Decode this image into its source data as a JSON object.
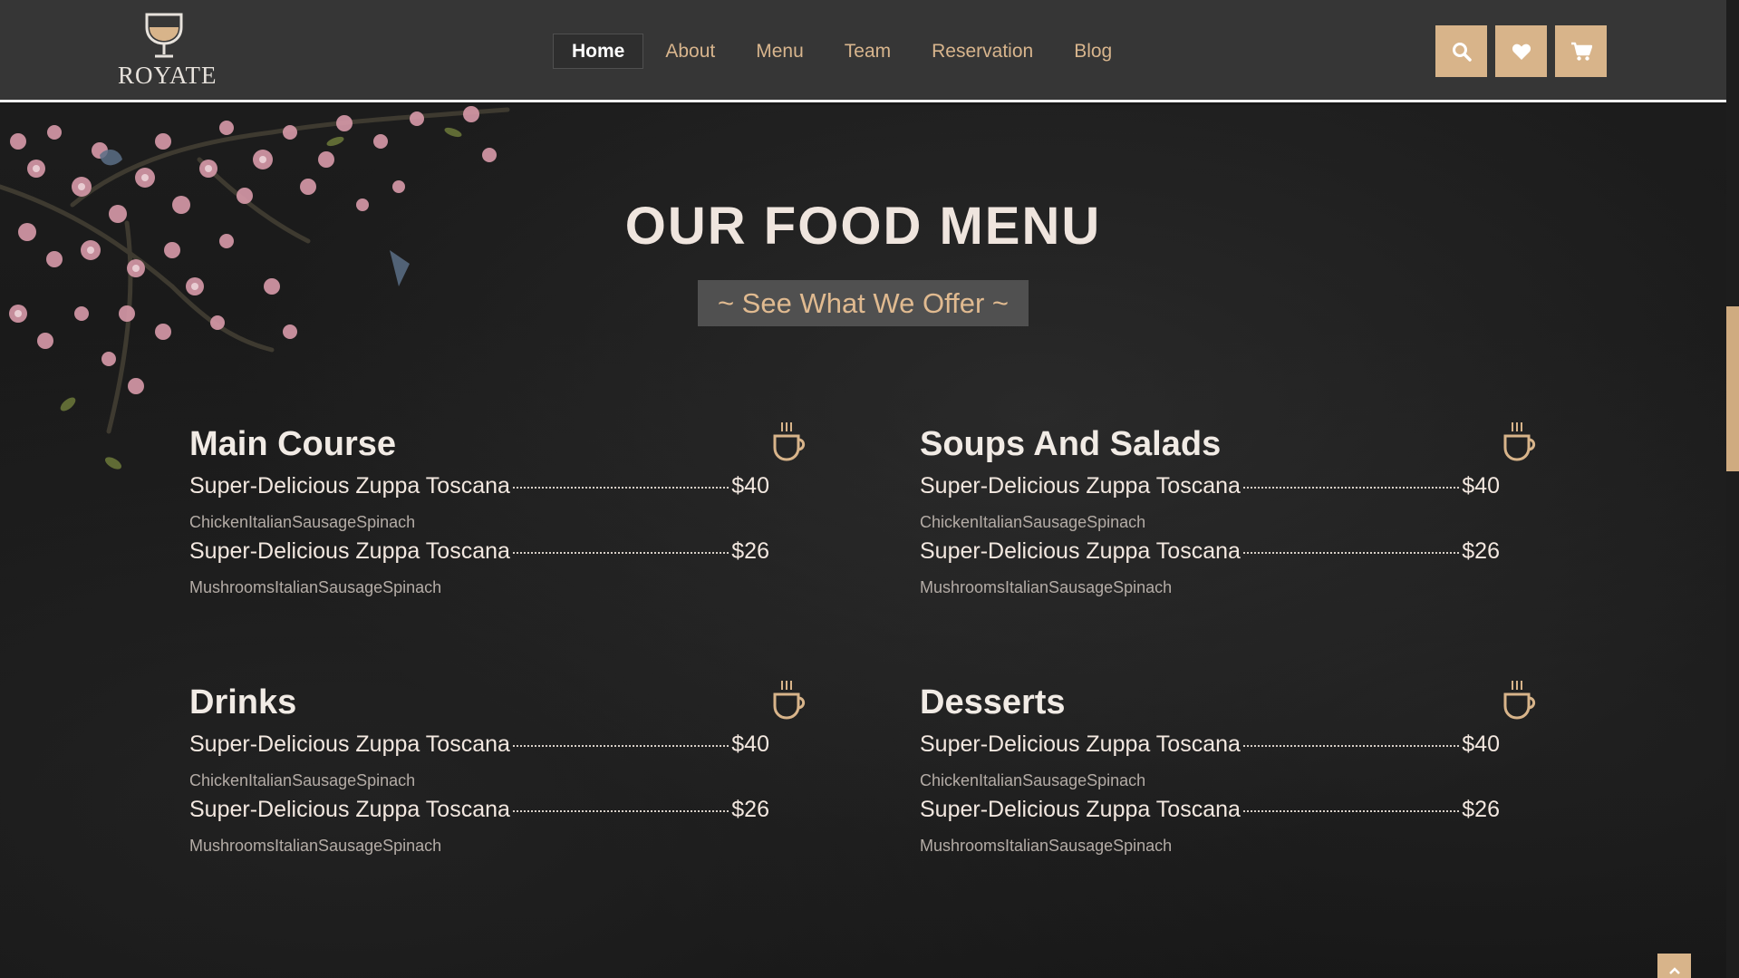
{
  "brand": {
    "name": "ROYATE"
  },
  "nav": {
    "items": [
      {
        "label": "Home",
        "active": true
      },
      {
        "label": "About",
        "active": false
      },
      {
        "label": "Menu",
        "active": false
      },
      {
        "label": "Team",
        "active": false
      },
      {
        "label": "Reservation",
        "active": false
      },
      {
        "label": "Blog",
        "active": false
      }
    ]
  },
  "header_icons": [
    "search-icon",
    "heart-icon",
    "cart-icon"
  ],
  "section": {
    "title": "OUR FOOD MENU",
    "subtitle": "~ See What We Offer ~"
  },
  "menu": [
    {
      "title": "Main Course",
      "items": [
        {
          "name": "Super-Delicious Zuppa Toscana",
          "price": "$40",
          "desc": "ChickenItalianSausageSpinach"
        },
        {
          "name": "Super-Delicious Zuppa Toscana",
          "price": "$26",
          "desc": "MushroomsItalianSausageSpinach"
        }
      ]
    },
    {
      "title": "Soups And Salads",
      "items": [
        {
          "name": "Super-Delicious Zuppa Toscana",
          "price": "$40",
          "desc": "ChickenItalianSausageSpinach"
        },
        {
          "name": "Super-Delicious Zuppa Toscana",
          "price": "$26",
          "desc": "MushroomsItalianSausageSpinach"
        }
      ]
    },
    {
      "title": "Drinks",
      "items": [
        {
          "name": "Super-Delicious Zuppa Toscana",
          "price": "$40",
          "desc": "ChickenItalianSausageSpinach"
        },
        {
          "name": "Super-Delicious Zuppa Toscana",
          "price": "$26",
          "desc": "MushroomsItalianSausageSpinach"
        }
      ]
    },
    {
      "title": "Desserts",
      "items": [
        {
          "name": "Super-Delicious Zuppa Toscana",
          "price": "$40",
          "desc": "ChickenItalianSausageSpinach"
        },
        {
          "name": "Super-Delicious Zuppa Toscana",
          "price": "$26",
          "desc": "MushroomsItalianSausageSpinach"
        }
      ]
    }
  ],
  "colors": {
    "accent": "#d8b48a",
    "header_bg": "#363636",
    "page_bg": "#1a1a1a"
  }
}
